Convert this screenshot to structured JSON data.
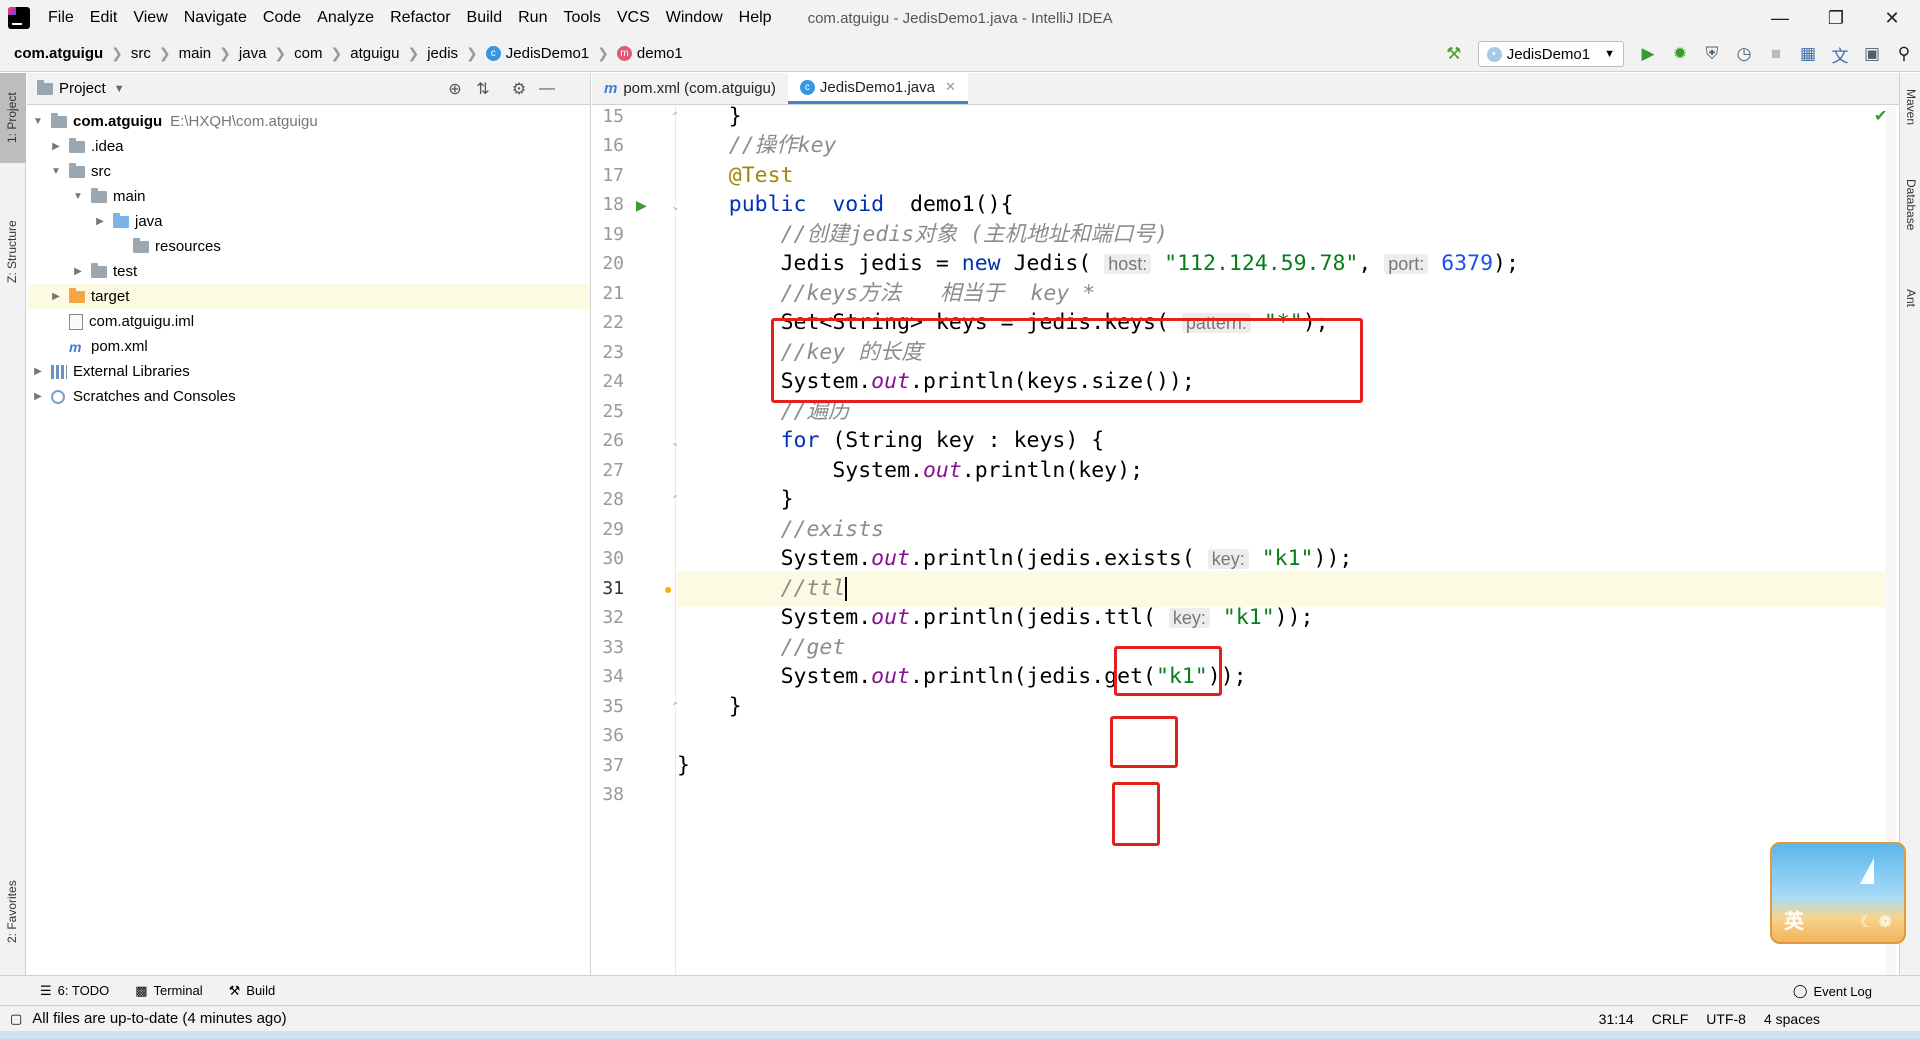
{
  "menubar": {
    "items": [
      "File",
      "Edit",
      "View",
      "Navigate",
      "Code",
      "Analyze",
      "Refactor",
      "Build",
      "Run",
      "Tools",
      "VCS",
      "Window",
      "Help"
    ],
    "window_title": "com.atguigu - JedisDemo1.java - IntelliJ IDEA"
  },
  "navbar": {
    "crumbs": [
      "com.atguigu",
      "src",
      "main",
      "java",
      "com",
      "atguigu",
      "jedis",
      "JedisDemo1",
      "demo1"
    ],
    "run_config": "JedisDemo1"
  },
  "left_strip": {
    "project_tab": "1: Project",
    "structure_tab": "Z: Structure",
    "favorites_tab": "2: Favorites"
  },
  "project_panel": {
    "title": "Project",
    "tree": [
      {
        "label": "com.atguigu",
        "path": "E:\\HXQH\\com.atguigu"
      },
      {
        "label": ".idea"
      },
      {
        "label": "src"
      },
      {
        "label": "main"
      },
      {
        "label": "java"
      },
      {
        "label": "resources"
      },
      {
        "label": "test"
      },
      {
        "label": "target"
      },
      {
        "label": "com.atguigu.iml"
      },
      {
        "label": "pom.xml"
      },
      {
        "label": "External Libraries"
      },
      {
        "label": "Scratches and Consoles"
      }
    ]
  },
  "editor": {
    "tabs": [
      {
        "label": "pom.xml (com.atguigu)"
      },
      {
        "label": "JedisDemo1.java"
      }
    ],
    "line_numbers": [
      "15",
      "16",
      "17",
      "18",
      "19",
      "20",
      "21",
      "22",
      "23",
      "24",
      "25",
      "26",
      "27",
      "28",
      "29",
      "30",
      "31",
      "32",
      "33",
      "34",
      "35",
      "36",
      "37",
      "38"
    ],
    "code": {
      "l15": "    }",
      "l16_comment": "//操作key",
      "l17_annotation": "@Test",
      "l18_public": "public",
      "l18_void": "void",
      "l18_rest": "demo1(){",
      "l19_comment": "//创建jedis对象 (主机地址和端口号)",
      "l20_a": "Jedis jedis = ",
      "l20_new": "new",
      "l20_b": " Jedis(",
      "l20_hint_host": "host:",
      "l20_str_host": "\"112.124.59.78\"",
      "l20_comma": ",",
      "l20_hint_port": "port:",
      "l20_num_port": "6379",
      "l20_end": ");",
      "l21_comment": "//keys方法   相当于  key *",
      "l22_a": "Set<String> keys = jedis.keys(",
      "l22_hint": "pattern:",
      "l22_str": "\"*\"",
      "l22_end": ");",
      "l23_comment": "//key 的长度",
      "l24_a": "System.",
      "l24_out": "out",
      "l24_b": ".println(keys.size());",
      "l25_comment": "//遍历",
      "l26_for": "for",
      "l26_b": " (String key : keys) {",
      "l27_a": "System.",
      "l27_out": "out",
      "l27_b": ".println(key);",
      "l28": "}",
      "l29_comment": "//exists",
      "l30_a": "System.",
      "l30_out": "out",
      "l30_b": ".println(jedis.exists(",
      "l30_hint": "key:",
      "l30_str": "\"k1\"",
      "l30_end": "));",
      "l31_comment": "//ttl",
      "l32_a": "System.",
      "l32_out": "out",
      "l32_b": ".println(jedis.ttl(",
      "l32_hint": "key:",
      "l32_str": "\"k1\"",
      "l32_end": "));",
      "l33_comment": "//get",
      "l34_a": "System.",
      "l34_out": "out",
      "l34_b": ".println(jedis.get(",
      "l34_str": "\"k1\"",
      "l34_end": "));",
      "l35": "}",
      "l37": "}"
    }
  },
  "right_strip": {
    "maven": "Maven",
    "database": "Database",
    "ant": "Ant"
  },
  "toolwindow_bar": {
    "todo": "6: TODO",
    "terminal": "Terminal",
    "build": "Build",
    "event_log": "Event Log"
  },
  "statusbar": {
    "message": "All files are up-to-date (4 minutes ago)",
    "position": "31:14",
    "line_sep": "CRLF",
    "encoding": "UTF-8",
    "indent": "4 spaces"
  },
  "ime": {
    "label": "英"
  },
  "colors": {
    "keyword": "#0033b3",
    "comment": "#8c8c8c",
    "string": "#067d17",
    "annotation": "#9e880d",
    "highlight_box": "#e5201c",
    "current_line": "#fcfae3"
  }
}
